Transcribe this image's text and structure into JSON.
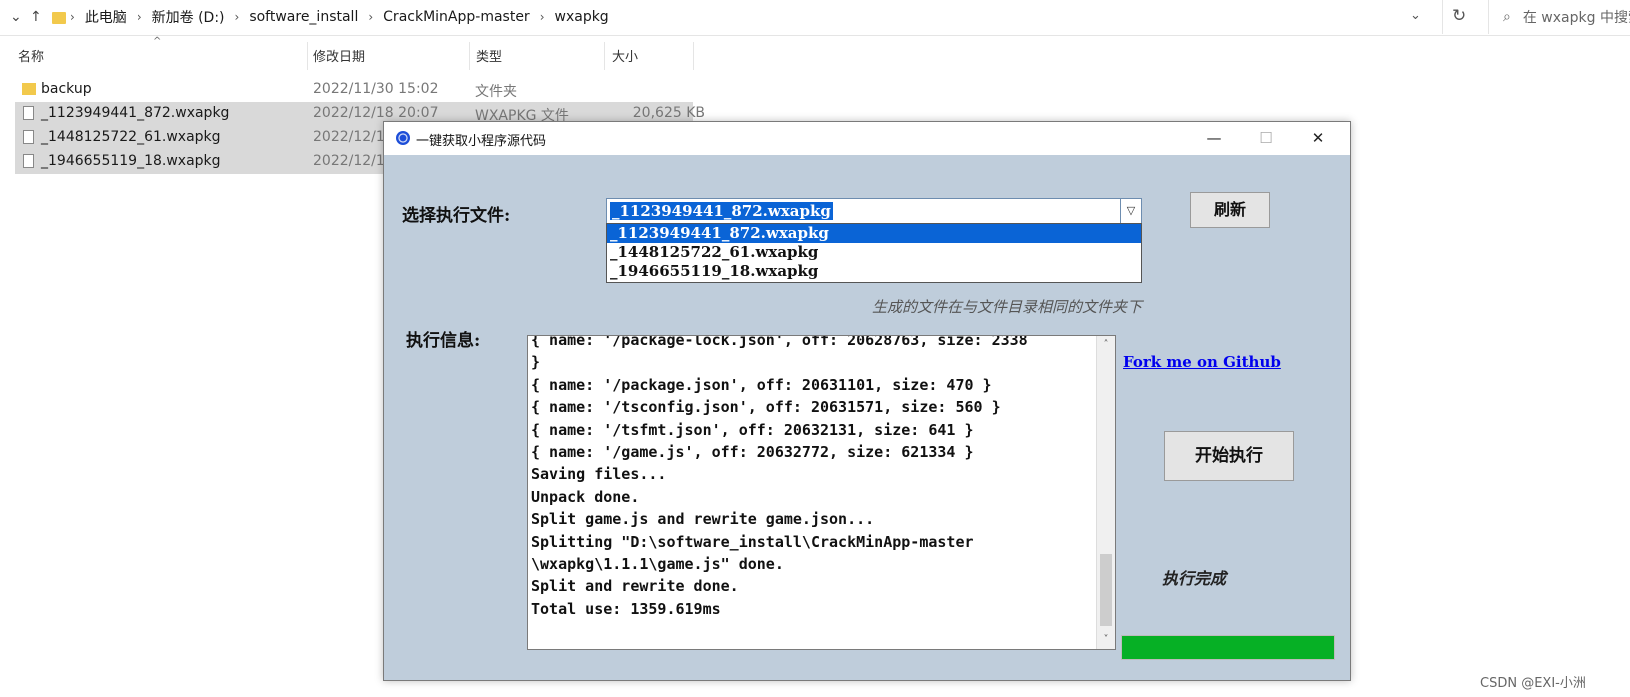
{
  "explorer": {
    "breadcrumbs": [
      "此电脑",
      "新加卷 (D:)",
      "software_install",
      "CrackMinApp-master",
      "wxapkg"
    ],
    "search_placeholder": "在 wxapkg 中搜索",
    "columns": {
      "name": "名称",
      "date": "修改日期",
      "type": "类型",
      "size": "大小"
    },
    "rows": [
      {
        "name": "backup",
        "date": "2022/11/30 15:02",
        "type": "文件夹",
        "size": "",
        "kind": "folder",
        "selected": false
      },
      {
        "name": "_1123949441_872.wxapkg",
        "date": "2022/12/18 20:07",
        "type": "WXAPKG 文件",
        "size": "20,625 KB",
        "kind": "file",
        "selected": true
      },
      {
        "name": "_1448125722_61.wxapkg",
        "date": "2022/12/1",
        "type": "",
        "size": "",
        "kind": "file",
        "selected": true
      },
      {
        "name": "_1946655119_18.wxapkg",
        "date": "2022/12/1",
        "type": "",
        "size": "",
        "kind": "file",
        "selected": true
      }
    ]
  },
  "dialog": {
    "title": "一键获取小程序源代码",
    "window_controls": {
      "minimize": "—",
      "maximize": "☐",
      "close": "✕"
    },
    "select_label": "选择执行文件:",
    "selected_file": "_1123949441_872.wxapkg",
    "options": [
      "_1123949441_872.wxapkg",
      "_1448125722_61.wxapkg",
      "_1946655119_18.wxapkg"
    ],
    "refresh_button": "刷新",
    "hint": "生成的文件在与文件目录相同的文件夹下",
    "info_label": "执行信息:",
    "log_lines": [
      "{ name: '/package-lock.json', off: 20628763, size: 2338",
      "}",
      "{ name: '/package.json', off: 20631101, size: 470 }",
      "{ name: '/tsconfig.json', off: 20631571, size: 560 }",
      "{ name: '/tsfmt.json', off: 20632131, size: 641 }",
      "{ name: '/game.js', off: 20632772, size: 621334 }",
      "Saving files...",
      "Unpack done.",
      "Split game.js and rewrite game.json...",
      "Splitting \"D:\\software_install\\CrackMinApp-master",
      "\\wxapkg\\1.1.1\\game.js\" done.",
      "Split and rewrite done.",
      "Total use: 1359.619ms"
    ],
    "github_link": "Fork me on Github",
    "start_button": "开始执行",
    "status": "执行完成",
    "progress": 1.0,
    "progress_color": "#06b025"
  },
  "watermark": "CSDN @EXI-小洲"
}
